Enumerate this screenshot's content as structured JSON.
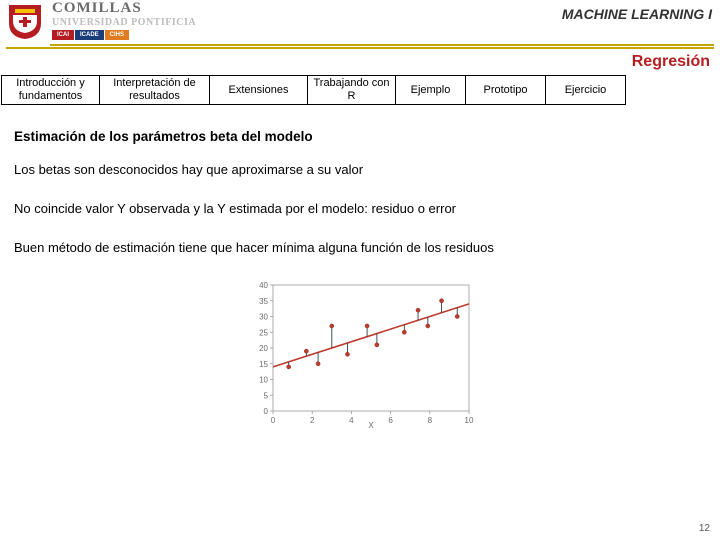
{
  "header": {
    "university": "COMILLAS",
    "subtitle": "UNIVERSIDAD PONTIFICIA",
    "bars": [
      "ICAI",
      "ICADE",
      "CIHS"
    ],
    "course": "MACHINE LEARNING I"
  },
  "section_title": "Regresión",
  "tabs": [
    {
      "label": "Introducción y fundamentos",
      "active": true
    },
    {
      "label": "Interpretación de resultados",
      "active": false
    },
    {
      "label": "Extensiones",
      "active": false
    },
    {
      "label": "Trabajando con R",
      "active": false
    },
    {
      "label": "Ejemplo",
      "active": false
    },
    {
      "label": "Prototipo",
      "active": false
    },
    {
      "label": "Ejercicio",
      "active": false
    }
  ],
  "content": {
    "subhead": "Estimación de los parámetros beta del modelo",
    "p1": "Los betas son desconocidos hay que aproximarse a su valor",
    "p2": "No coincide valor Y observada y la Y estimada por el modelo: residuo o error",
    "p3": "Buen método de estimación tiene que hacer mínima alguna función de los residuos"
  },
  "chart_data": {
    "type": "scatter",
    "title": "",
    "xlabel": "X",
    "ylabel": "",
    "xlim": [
      0,
      10
    ],
    "ylim": [
      0,
      40
    ],
    "xticks": [
      0,
      2,
      4,
      6,
      8,
      10
    ],
    "yticks": [
      0,
      5,
      10,
      15,
      20,
      25,
      30,
      35,
      40
    ],
    "line": {
      "x1": 0,
      "y1": 14,
      "x2": 10,
      "y2": 34
    },
    "points": [
      {
        "x": 0.8,
        "y": 14
      },
      {
        "x": 1.7,
        "y": 19
      },
      {
        "x": 2.3,
        "y": 15
      },
      {
        "x": 3.0,
        "y": 27
      },
      {
        "x": 3.8,
        "y": 18
      },
      {
        "x": 4.8,
        "y": 27
      },
      {
        "x": 5.3,
        "y": 21
      },
      {
        "x": 6.7,
        "y": 25
      },
      {
        "x": 7.4,
        "y": 32
      },
      {
        "x": 7.9,
        "y": 27
      },
      {
        "x": 8.6,
        "y": 35
      },
      {
        "x": 9.4,
        "y": 30
      }
    ]
  },
  "page_number": "12"
}
